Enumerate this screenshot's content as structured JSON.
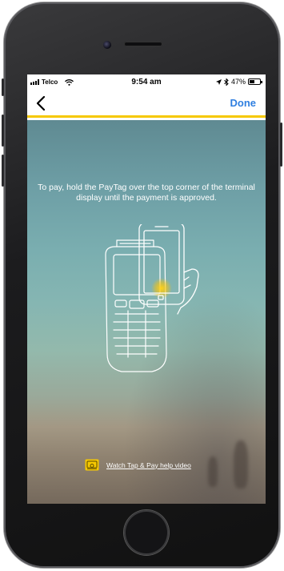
{
  "status_bar": {
    "carrier": "Telco",
    "time": "9:54 am",
    "battery_percent": "47%",
    "battery_level": 0.47
  },
  "nav": {
    "done_label": "Done",
    "accent_color": "#f6c800",
    "link_color": "#2f7fe0"
  },
  "main": {
    "instruction": "To pay, hold the PayTag over the top corner of the terminal display until the payment is approved.",
    "help_link": "Watch Tap & Pay help video"
  },
  "icons": {
    "back": "chevron-left-icon",
    "video": "video-icon",
    "location": "location-arrow-icon",
    "bluetooth": "bluetooth-icon",
    "wifi": "wifi-icon",
    "signal": "signal-bars-icon",
    "battery": "battery-icon"
  }
}
